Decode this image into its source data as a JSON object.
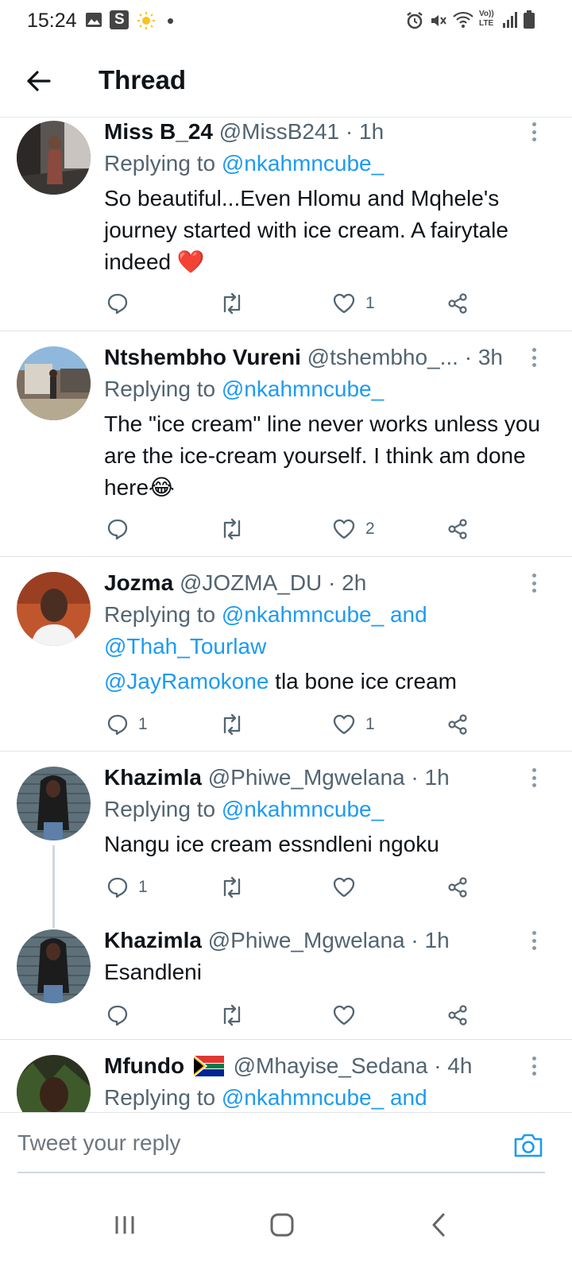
{
  "status_bar": {
    "time": "15:24",
    "s_badge": "S",
    "volte": "Vo)) LTE"
  },
  "header": {
    "title": "Thread"
  },
  "tweets": [
    {
      "name": "Miss B_24",
      "handle": "@MissB241",
      "time": "· 1h",
      "replying_prefix": "Replying to",
      "replying_to": "@nkahmncube_",
      "text": "So beautiful...Even Hlomu and Mqhele's journey started with ice cream. A fairytale indeed ❤️",
      "replies": "",
      "likes": "1"
    },
    {
      "name": "Ntshembho Vureni",
      "handle": "@tshembho_...",
      "time": "· 3h",
      "replying_prefix": "Replying to",
      "replying_to": "@nkahmncube_",
      "text": "The \"ice cream\" line never works unless you are the ice-cream yourself. I think am done here😂",
      "replies": "",
      "likes": "2"
    },
    {
      "name": "Jozma",
      "handle": "@JOZMA_DU",
      "time": "· 2h",
      "replying_prefix": "Replying to",
      "replying_to": "@nkahmncube_ and @Thah_Tourlaw",
      "mention": "@JayRamokone",
      "text": " tla bone ice cream",
      "replies": "1",
      "likes": "1"
    },
    {
      "name": "Khazimla",
      "handle": "@Phiwe_Mgwelana",
      "time": "· 1h",
      "replying_prefix": "Replying to",
      "replying_to": "@nkahmncube_",
      "text": "Nangu ice cream essndleni ngoku",
      "replies": "1",
      "likes": ""
    },
    {
      "name": "Khazimla",
      "handle": "@Phiwe_Mgwelana",
      "time": "· 1h",
      "text": "Esandleni",
      "replies": "",
      "likes": ""
    },
    {
      "name": "Mfundo",
      "handle": "@Mhayise_Sedana",
      "time": "· 4h",
      "replying_prefix": "Replying to",
      "replying_to": "@nkahmncube_ and"
    }
  ],
  "compose": {
    "placeholder": "Tweet your reply"
  },
  "colors": {
    "link": "#1d9bf0",
    "secondary_text": "#536471",
    "heart": "#e0245e"
  }
}
